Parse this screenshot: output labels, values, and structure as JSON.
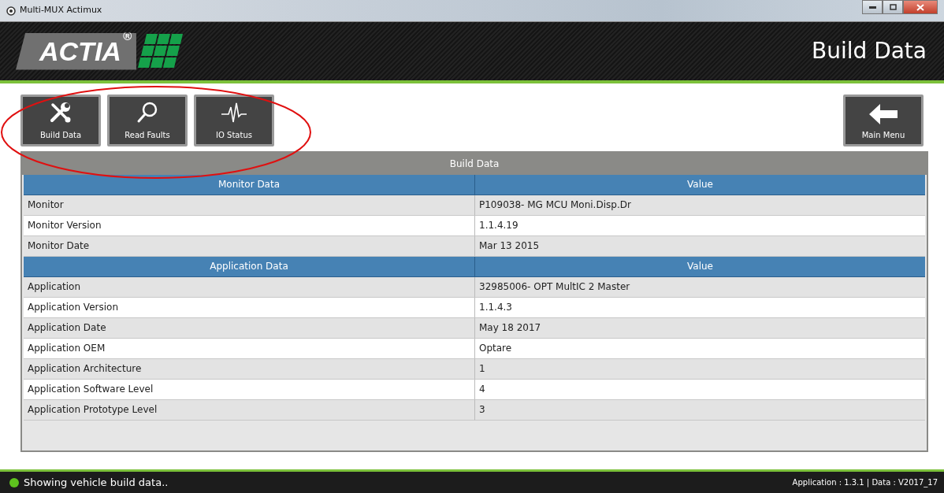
{
  "window": {
    "title": "Multi-MUX Actimux"
  },
  "header": {
    "logo": "ACTIA",
    "logo_mark": "®",
    "title": "Build Data"
  },
  "toolbar": [
    {
      "label": "Build Data",
      "kind": "tools"
    },
    {
      "label": "Read Faults",
      "kind": "search"
    },
    {
      "label": "IO Status",
      "kind": "pulse"
    }
  ],
  "main_menu_button": {
    "label": "Main Menu"
  },
  "panel": {
    "title": "Build Data",
    "sections": [
      {
        "columns": [
          "Monitor Data",
          "Value"
        ],
        "rows": [
          [
            "Monitor",
            "P109038- MG MCU Moni.Disp.Dr"
          ],
          [
            "Monitor Version",
            "1.1.4.19"
          ],
          [
            "Monitor Date",
            "Mar 13 2015"
          ]
        ]
      },
      {
        "columns": [
          "Application Data",
          "Value"
        ],
        "rows": [
          [
            "Application",
            "32985006- OPT MultIC 2 Master"
          ],
          [
            "Application Version",
            "1.1.4.3"
          ],
          [
            "Application Date",
            "May 18 2017"
          ],
          [
            "Application OEM",
            "Optare"
          ],
          [
            "Application Architecture",
            "1"
          ],
          [
            "Application Software Level",
            "4"
          ],
          [
            "Application Prototype Level",
            "3"
          ]
        ]
      }
    ]
  },
  "status_bar": {
    "message": "Showing vehicle build data..",
    "version_info": "Application : 1.3.1 | Data : V2017_17"
  }
}
